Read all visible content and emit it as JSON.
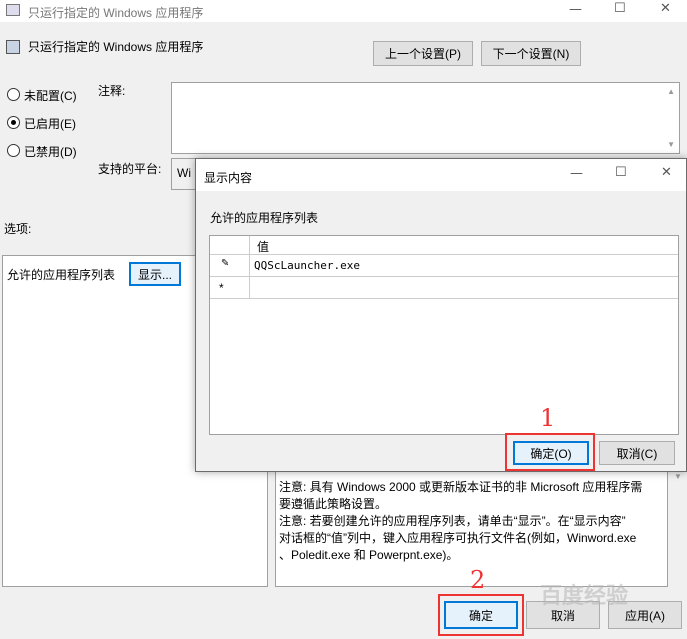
{
  "main_window": {
    "title": "只运行指定的 Windows 应用程序",
    "header_title": "只运行指定的 Windows 应用程序",
    "prev_button": "上一个设置(P)",
    "next_button": "下一个设置(N)",
    "radio_not_configured": "未配置(C)",
    "radio_enabled": "已启用(E)",
    "radio_disabled": "已禁用(D)",
    "comment_label": "注释:",
    "platform_label": "支持的平台:",
    "platform_value": "Wi",
    "options_label": "选项:",
    "allowed_list_label": "允许的应用程序列表",
    "show_button": "显示...",
    "help_line1": "注意: 具有 Windows 2000 或更新版本证书的非 Microsoft 应用程序需",
    "help_line2": "要遵循此策略设置。",
    "help_line3": "注意: 若要创建允许的应用程序列表，请单击“显示”。在“显示内容”",
    "help_line4": "对话框的“值”列中，键入应用程序可执行文件名(例如，Winword.exe",
    "help_line5": "、Poledit.exe 和 Powerpnt.exe)。",
    "ok_button": "确定",
    "cancel_button": "取消",
    "apply_button": "应用(A)"
  },
  "dialog": {
    "title": "显示内容",
    "list_label": "允许的应用程序列表",
    "column_header": "值",
    "rows": [
      "QQScLauncher.exe",
      ""
    ],
    "ok_button": "确定(O)",
    "cancel_button": "取消(C)"
  },
  "annotations": {
    "marker_1": "1",
    "marker_2": "2"
  },
  "watermark": "百度经验",
  "colors": {
    "focus_border": "#0078d7",
    "annotation_red": "#e33333",
    "window_bg": "#f0f0f0"
  }
}
